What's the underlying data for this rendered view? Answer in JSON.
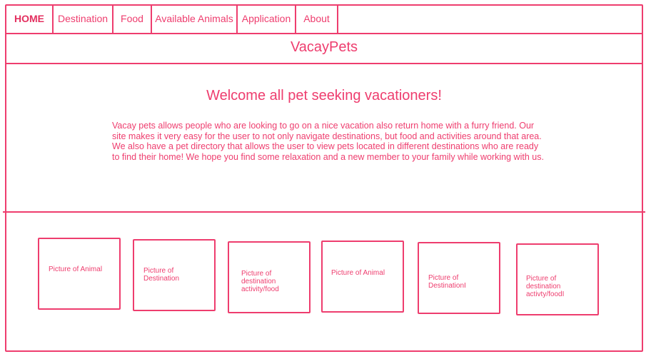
{
  "nav": {
    "items": [
      {
        "label": "HOME",
        "active": true
      },
      {
        "label": "Destination",
        "active": false
      },
      {
        "label": "Food",
        "active": false
      },
      {
        "label": "Available Animals",
        "active": false
      },
      {
        "label": "Application",
        "active": false
      },
      {
        "label": "About",
        "active": false
      }
    ]
  },
  "site": {
    "title": "VacayPets"
  },
  "hero": {
    "heading": "Welcome all pet seeking vacationers!",
    "body": "Vacay pets allows people who are looking to go on a nice vacation also return home with a furry friend. Our site makes it very easy for the user to not only navigate destinations, but food and activities around that area. We also have a pet directory that allows the user to view pets located in different destinations who are ready to find their home! We hope you find some relaxation and a new member to your family while working with us."
  },
  "gallery": {
    "cards": [
      {
        "label": "Picture of Animal"
      },
      {
        "label": "Picture of Destination"
      },
      {
        "label": "Picture of destination activity/food"
      },
      {
        "label": "Picture of Animal"
      },
      {
        "label": "Picture of DestinationI"
      },
      {
        "label": "Picture of destination activty/foodI"
      }
    ]
  },
  "colors": {
    "accent": "#ee3d6e",
    "background": "#ffffff"
  }
}
